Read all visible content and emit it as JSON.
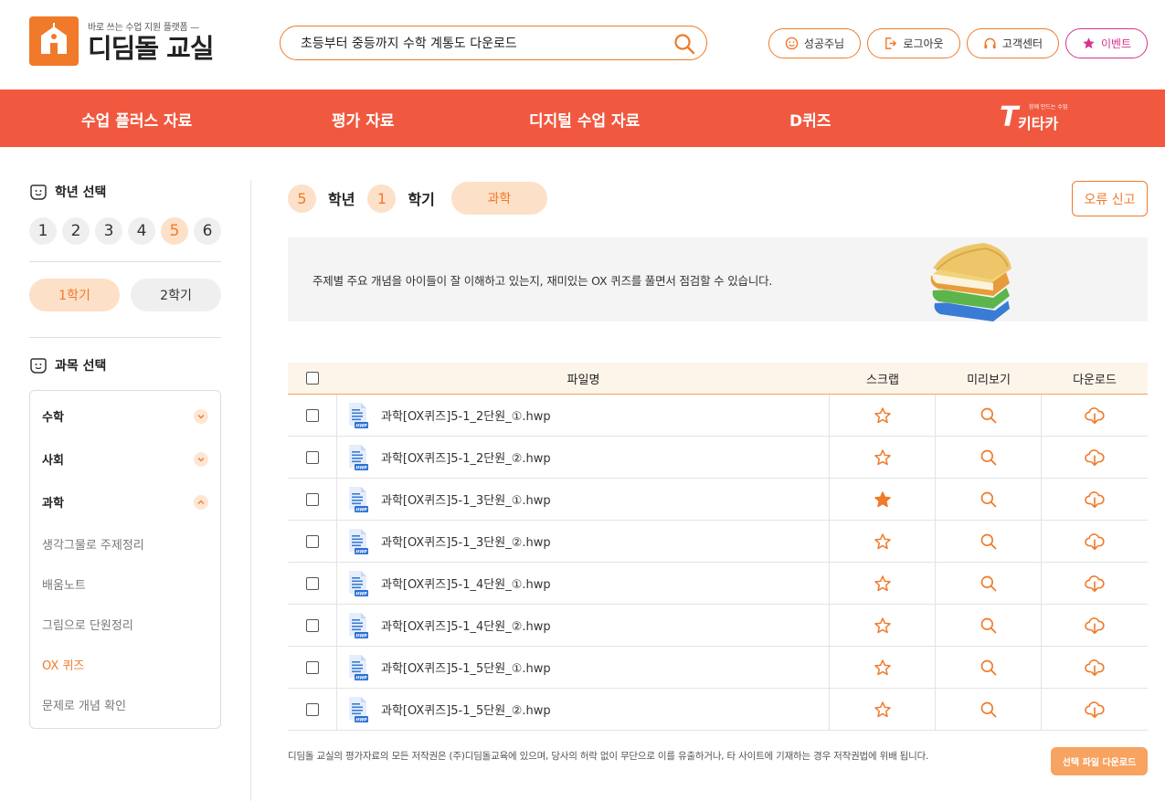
{
  "header": {
    "logo_sub": "바로 쓰는 수업 지원 플랫폼 —",
    "logo_main": "디딤돌 교실",
    "search_value": "초등부터 중등까지 수학 계통도 다운로드",
    "buttons": [
      "성공주님",
      "로그아웃",
      "고객센터",
      "이벤트"
    ]
  },
  "nav": {
    "items": [
      "수업 플러스 자료",
      "평가 자료",
      "디지털 수업 자료",
      "D퀴즈"
    ],
    "kitaka_label": "키타카",
    "kitaka_sub": "함께 만드는 수업"
  },
  "sidebar": {
    "grade_title": "학년 선택",
    "grades": [
      "1",
      "2",
      "3",
      "4",
      "5",
      "6"
    ],
    "active_grade": "5",
    "terms": [
      "1학기",
      "2학기"
    ],
    "active_term": "1학기",
    "subject_title": "과목 선택",
    "subjects": [
      "수학",
      "사회",
      "과학"
    ],
    "sub_items": [
      "생각그물로 주제정리",
      "배움노트",
      "그림으로 단원정리",
      "OX 퀴즈",
      "문제로 개념 확인"
    ],
    "active_sub": "OX 퀴즈"
  },
  "main": {
    "grade": "5",
    "grade_label": "학년",
    "term": "1",
    "term_label": "학기",
    "subject": "과학",
    "report_button": "오류 신고",
    "banner_text": "주제별 주요 개념을 아이들이 잘 이해하고 있는지, 재미있는 OX 퀴즈를 풀면서 점검할 수 있습니다.",
    "table": {
      "headers": [
        "파일명",
        "스크랩",
        "미리보기",
        "다운로드"
      ],
      "rows": [
        {
          "name": "과학[OX퀴즈]5-1_2단원_①.hwp",
          "scrapped": false
        },
        {
          "name": "과학[OX퀴즈]5-1_2단원_②.hwp",
          "scrapped": false
        },
        {
          "name": "과학[OX퀴즈]5-1_3단원_①.hwp",
          "scrapped": true
        },
        {
          "name": "과학[OX퀴즈]5-1_3단원_②.hwp",
          "scrapped": false
        },
        {
          "name": "과학[OX퀴즈]5-1_4단원_①.hwp",
          "scrapped": false
        },
        {
          "name": "과학[OX퀴즈]5-1_4단원_②.hwp",
          "scrapped": false
        },
        {
          "name": "과학[OX퀴즈]5-1_5단원_①.hwp",
          "scrapped": false
        },
        {
          "name": "과학[OX퀴즈]5-1_5단원_②.hwp",
          "scrapped": false
        }
      ],
      "file_badge": "HWP"
    },
    "footer_note": "디딤돌 교실의 평가자료의 모든 저작권은 (주)디딤돌교육에 있으며, 당사의 허락 없이 무단으로 이를 유출하거나, 타 사이트에 기재하는 경우 저작권법에 위배 됩니다.",
    "download_selected": "선택 파일 다운로드"
  },
  "colors": {
    "accent": "#f07a2a",
    "nav_bg": "#f0593f",
    "event": "#d6348c",
    "pill_bg": "#fde0c8"
  }
}
